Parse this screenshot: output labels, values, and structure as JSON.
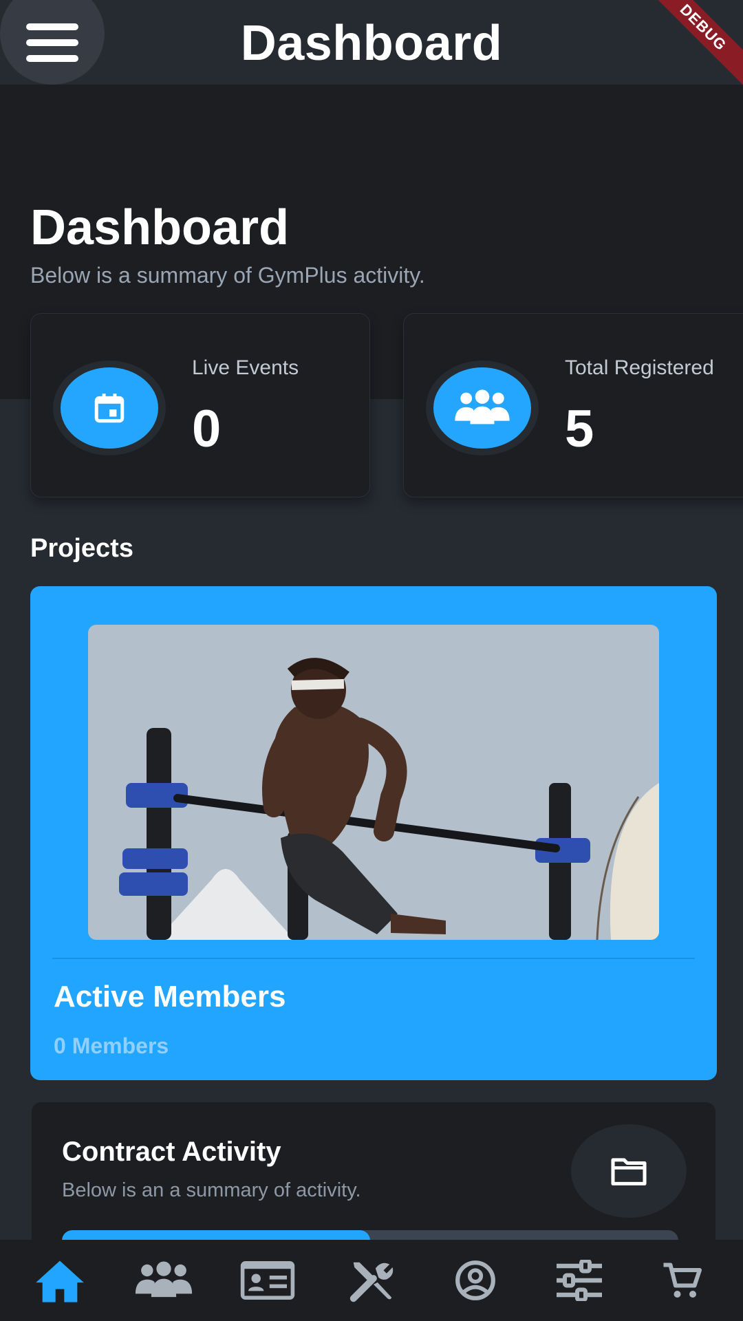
{
  "app_bar": {
    "title": "Dashboard",
    "debug_banner": "DEBUG"
  },
  "header": {
    "title": "Dashboard",
    "subtitle": "Below is a summary of GymPlus activity."
  },
  "stats": [
    {
      "label": "Live Events",
      "value": "0",
      "icon": "calendar-icon"
    },
    {
      "label": "Total Registered",
      "value": "5",
      "icon": "people-icon"
    }
  ],
  "projects": {
    "section_title": "Projects",
    "card": {
      "title": "Active Members",
      "subtitle": "0 Members",
      "image": "athlete-dips-photo"
    }
  },
  "contract": {
    "title": "Contract Activity",
    "subtitle": "Below is an a summary of activity.",
    "icon": "folder-icon",
    "progress": 0.5
  },
  "bottom_nav": [
    {
      "name": "home",
      "icon": "home-icon",
      "active": true
    },
    {
      "name": "members",
      "icon": "group-icon",
      "active": false
    },
    {
      "name": "id-card",
      "icon": "id-card-icon",
      "active": false
    },
    {
      "name": "tools",
      "icon": "tools-icon",
      "active": false
    },
    {
      "name": "profile",
      "icon": "account-circle-icon",
      "active": false
    },
    {
      "name": "settings",
      "icon": "sliders-icon",
      "active": false
    },
    {
      "name": "cart",
      "icon": "cart-icon",
      "active": false
    }
  ],
  "colors": {
    "accent": "#22a5fe",
    "background": "#262a31",
    "surface": "#1c1e22",
    "nav_inactive": "#a9b1bb"
  }
}
